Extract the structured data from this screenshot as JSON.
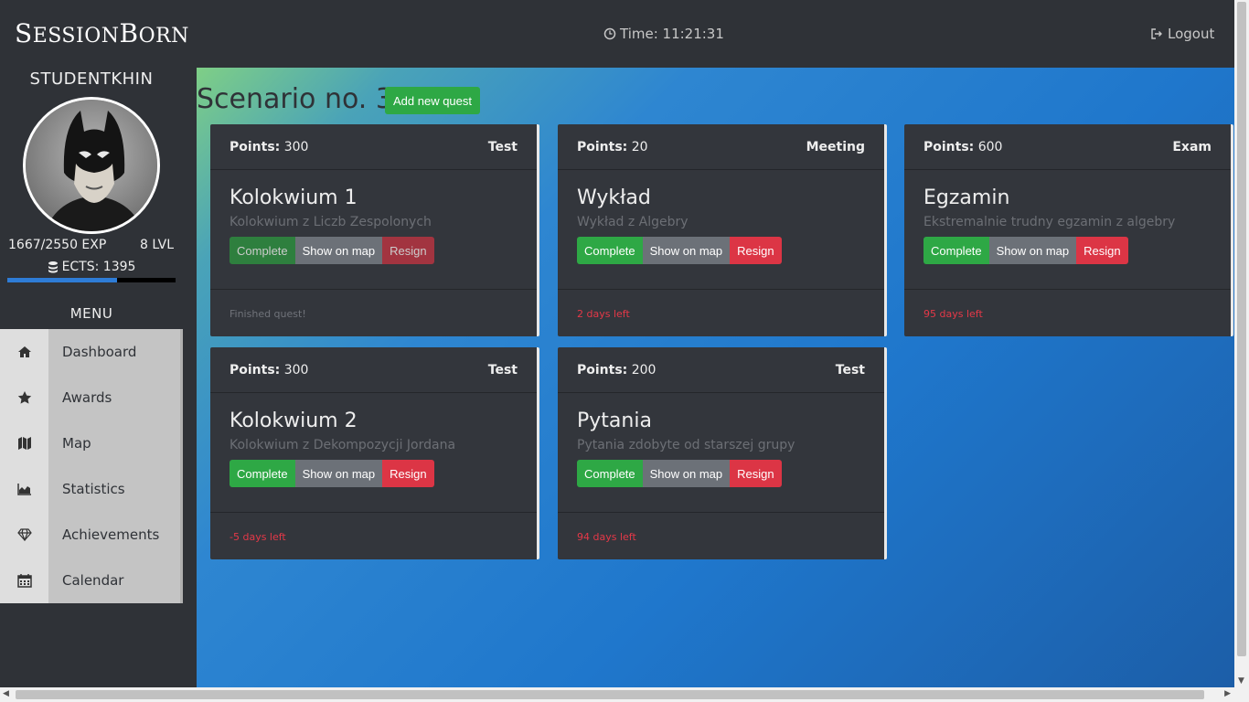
{
  "navbar": {
    "brand_first_letter": "S",
    "brand_rest_1": "ESSION",
    "brand_second_letter": "B",
    "brand_rest_2": "ORN",
    "time_label": "Time: 11:21:31",
    "logout_label": "Logout"
  },
  "profile": {
    "username": "STUDENTKHIN",
    "exp": "1667/2550 EXP",
    "level": "8 LVL",
    "ects": "ECTS: 1395",
    "exp_progress": 0.654
  },
  "menu": {
    "title": "MENU",
    "items": [
      {
        "label": "Dashboard",
        "icon": "home-icon"
      },
      {
        "label": "Awards",
        "icon": "star-icon"
      },
      {
        "label": "Map",
        "icon": "map-icon"
      },
      {
        "label": "Statistics",
        "icon": "area-chart-icon"
      },
      {
        "label": "Achievements",
        "icon": "diamond-icon"
      },
      {
        "label": "Calendar",
        "icon": "calendar-icon"
      }
    ]
  },
  "main": {
    "title": "Scenario no. 3",
    "add_button": "Add new quest",
    "points_label": "Points:",
    "quests": [
      {
        "points": "300",
        "type": "Test",
        "title": "Kolokwium 1",
        "subtitle": "Kolokwium z Liczb Zespolonych",
        "footer": "Finished quest!",
        "finished": true
      },
      {
        "points": "20",
        "type": "Meeting",
        "title": "Wykład",
        "subtitle": "Wykład z Algebry",
        "footer": "2 days left",
        "finished": false
      },
      {
        "points": "600",
        "type": "Exam",
        "title": "Egzamin",
        "subtitle": "Ekstremalnie trudny egzamin z algebry",
        "footer": "95 days left",
        "finished": false
      },
      {
        "points": "300",
        "type": "Test",
        "title": "Kolokwium 2",
        "subtitle": "Kolokwium z Dekompozycji Jordana",
        "footer": "-5 days left",
        "finished": false
      },
      {
        "points": "200",
        "type": "Test",
        "title": "Pytania",
        "subtitle": "Pytania zdobyte od starszej grupy",
        "footer": "94 days left",
        "finished": false
      }
    ],
    "btn_complete": "Complete",
    "btn_map": "Show on map",
    "btn_resign": "Resign"
  },
  "colors": {
    "sidebar_bg": "#2f3237",
    "card_bg": "#33363c",
    "accent_green": "#2ea845",
    "accent_red": "#dc3545",
    "accent_blue": "#2e7cd6"
  }
}
